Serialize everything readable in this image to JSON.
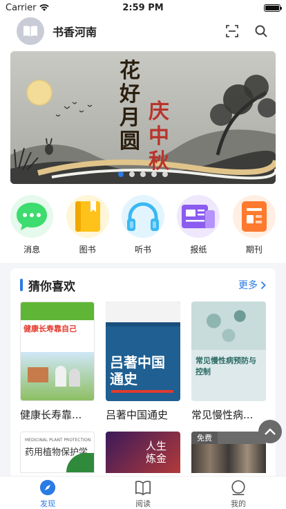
{
  "status": {
    "carrier": "Carrier",
    "time": "2:59 PM"
  },
  "header": {
    "title": "书香河南"
  },
  "banner": {
    "calligraphy_1": "花好月圆",
    "calligraphy_2": "庆中秋",
    "slide_count": 5,
    "active_slide": 1
  },
  "categories": [
    {
      "label": "消息",
      "icon": "chat-icon",
      "color": "#3ddc6e"
    },
    {
      "label": "图书",
      "icon": "book-icon",
      "color": "#ffc21a"
    },
    {
      "label": "听书",
      "icon": "headphones-icon",
      "color": "#3ab8f2"
    },
    {
      "label": "报纸",
      "icon": "newspaper-icon",
      "color": "#8b5cf0"
    },
    {
      "label": "期刊",
      "icon": "journal-icon",
      "color": "#ff7a2e"
    }
  ],
  "recommend": {
    "title": "猜你喜欢",
    "more": "更多",
    "books": [
      {
        "title": "健康长寿靠...",
        "cover_text": "健康长寿靠自己"
      },
      {
        "title": "吕著中国通史",
        "cover_text": "吕著中国通史"
      },
      {
        "title": "常见慢性病...",
        "cover_text": "常见慢性病预防与控制"
      }
    ],
    "books_row2": [
      {
        "cover_text": "药用植物保护学",
        "cover_sub": "MEDICINAL PLANT PROTECTION"
      },
      {
        "cover_text": "人生炼金"
      },
      {
        "cover_text": "免费",
        "badge": true
      }
    ]
  },
  "tabbar": [
    {
      "label": "发现",
      "icon": "compass-icon",
      "active": true
    },
    {
      "label": "阅读",
      "icon": "open-book-icon",
      "active": false
    },
    {
      "label": "我的",
      "icon": "profile-icon",
      "active": false
    }
  ],
  "colors": {
    "accent": "#2a7be4"
  }
}
